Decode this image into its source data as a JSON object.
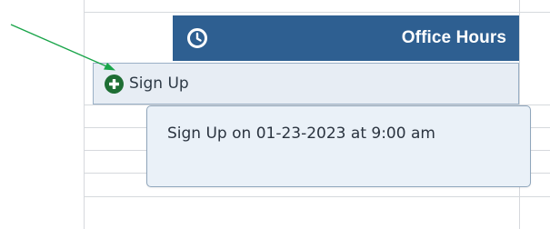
{
  "event": {
    "title": "Office Hours",
    "icon": "clock-icon",
    "header_color": "#2e5f91"
  },
  "signup": {
    "label": "Sign Up",
    "icon": "plus-circle-icon",
    "icon_color": "#1e6e34"
  },
  "tooltip": {
    "text": "Sign Up on 01-23-2023 at 9:00 am"
  },
  "annotation": {
    "icon": "arrow-annotation",
    "color": "#1aa54a"
  }
}
